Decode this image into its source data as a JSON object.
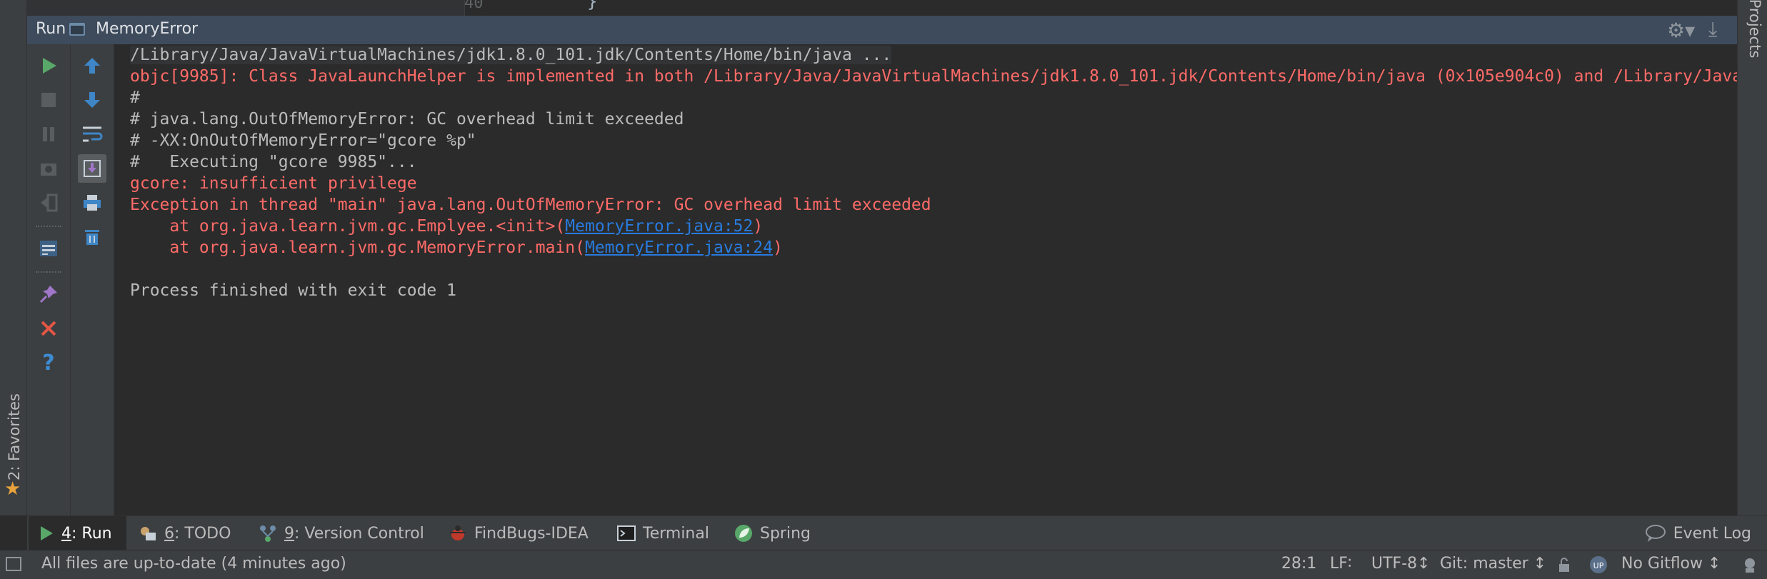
{
  "editor": {
    "line_number": "40",
    "code_remnant": "}"
  },
  "stripes": {
    "favorites_label": "2: Favorites",
    "projects_label": "Projects"
  },
  "run_panel": {
    "title": "Run",
    "config_name": "MemoryError"
  },
  "console": {
    "lines": [
      {
        "text": "/Library/Java/JavaVirtualMachines/jdk1.8.0_101.jdk/Contents/Home/bin/java ...",
        "style": "command"
      },
      {
        "text": "objc[9985]: Class JavaLaunchHelper is implemented in both /Library/Java/JavaVirtualMachines/jdk1.8.0_101.jdk/Contents/Home/bin/java (0x105e904c0) and /Library/Java/",
        "style": "error"
      },
      {
        "text": "#",
        "style": "normal"
      },
      {
        "text": "# java.lang.OutOfMemoryError: GC overhead limit exceeded",
        "style": "normal"
      },
      {
        "text": "# -XX:OnOutOfMemoryError=\"gcore %p\"",
        "style": "normal"
      },
      {
        "text": "#   Executing \"gcore 9985\"...",
        "style": "normal"
      },
      {
        "text": "gcore: insufficient privilege",
        "style": "error"
      },
      {
        "text": "Exception in thread \"main\" java.lang.OutOfMemoryError: GC overhead limit exceeded",
        "style": "error"
      },
      {
        "prefix": "    at org.java.learn.jvm.gc.Emplyee.<init>(",
        "link": "MemoryError.java:52",
        "suffix": ")",
        "style": "error"
      },
      {
        "prefix": "    at org.java.learn.jvm.gc.MemoryError.main(",
        "link": "MemoryError.java:24",
        "suffix": ")",
        "style": "error"
      },
      {
        "text": "",
        "style": "normal"
      },
      {
        "text": "Process finished with exit code 1",
        "style": "normal"
      }
    ]
  },
  "tool_windows": [
    {
      "num": "4",
      "label": ": Run",
      "icon": "run-icon",
      "active": true
    },
    {
      "num": "6",
      "label": ": TODO",
      "icon": "todo-icon",
      "active": false
    },
    {
      "num": "9",
      "label": ": Version Control",
      "icon": "version-control-icon",
      "active": false
    },
    {
      "num": "",
      "label": "FindBugs-IDEA",
      "icon": "findbugs-icon",
      "active": false
    },
    {
      "num": "",
      "label": "Terminal",
      "icon": "terminal-icon",
      "active": false
    },
    {
      "num": "",
      "label": "Spring",
      "icon": "spring-icon",
      "active": false
    }
  ],
  "event_log": "Event Log",
  "status_bar": {
    "message": "All files are up-to-date (4 minutes ago)",
    "position": "28:1",
    "line_separator": "LF∶",
    "encoding": "UTF-8↕",
    "git_branch": "Git: master ↕",
    "gitflow": "No Gitflow ↕"
  },
  "colors": {
    "background": "#2b2b2b",
    "panel": "#3c3f41",
    "header": "#3d4b5c",
    "error_text": "#ff6b68",
    "link": "#287bde",
    "run_green": "#59a869"
  }
}
